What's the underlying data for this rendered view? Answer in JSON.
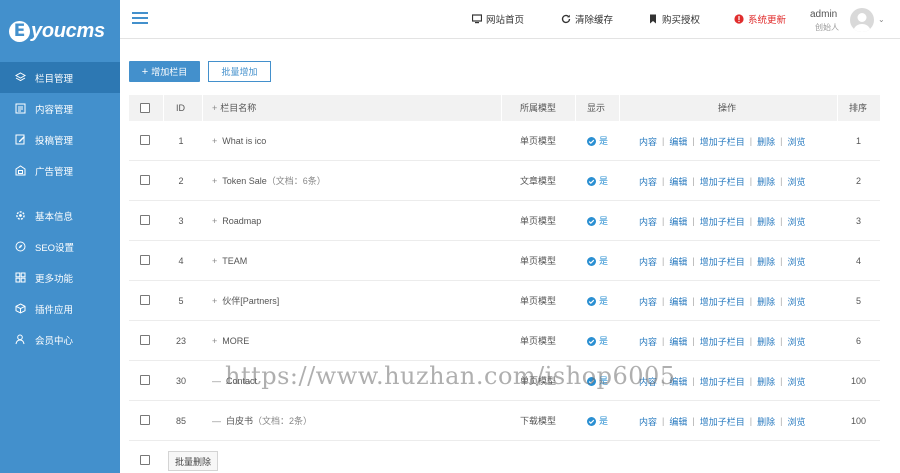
{
  "brand": {
    "logo_mark": "E",
    "logo_text": "youcms"
  },
  "sidebar": {
    "items": [
      {
        "label": "栏目管理",
        "icon": "layers-icon",
        "active": true
      },
      {
        "label": "内容管理",
        "icon": "document-icon",
        "active": false
      },
      {
        "label": "投稿管理",
        "icon": "edit-icon",
        "active": false
      },
      {
        "label": "广告管理",
        "icon": "ad-icon",
        "active": false
      },
      {
        "label": "基本信息",
        "icon": "gear-icon",
        "active": false
      },
      {
        "label": "SEO设置",
        "icon": "compass-icon",
        "active": false
      },
      {
        "label": "更多功能",
        "icon": "grid-icon",
        "active": false
      },
      {
        "label": "插件应用",
        "icon": "cube-icon",
        "active": false
      },
      {
        "label": "会员中心",
        "icon": "user-icon",
        "active": false
      }
    ]
  },
  "topbar": {
    "links": [
      {
        "label": "网站首页",
        "icon": "monitor-icon"
      },
      {
        "label": "清除缓存",
        "icon": "refresh-icon"
      },
      {
        "label": "购买授权",
        "icon": "bookmark-icon"
      },
      {
        "label": "系统更新",
        "icon": "alert-icon"
      }
    ],
    "user_name": "admin",
    "user_role": "创始人"
  },
  "toolbar": {
    "add_label": "增加栏目",
    "batch_label": "批量增加"
  },
  "table": {
    "headers": {
      "id": "ID",
      "name": "栏目名称",
      "model": "所属模型",
      "show": "显示",
      "ops": "操作",
      "sort": "排序"
    },
    "rows": [
      {
        "id": "1",
        "prefix": "+",
        "name": "What is ico",
        "doc": "",
        "model": "单页模型",
        "show": "是",
        "sort": "1"
      },
      {
        "id": "2",
        "prefix": "+",
        "name": "Token Sale",
        "doc": "（文档：6条）",
        "model": "文章模型",
        "show": "是",
        "sort": "2"
      },
      {
        "id": "3",
        "prefix": "+",
        "name": "Roadmap",
        "doc": "",
        "model": "单页模型",
        "show": "是",
        "sort": "3"
      },
      {
        "id": "4",
        "prefix": "+",
        "name": "TEAM",
        "doc": "",
        "model": "单页模型",
        "show": "是",
        "sort": "4"
      },
      {
        "id": "5",
        "prefix": "+",
        "name": "伙伴[Partners]",
        "doc": "",
        "model": "单页模型",
        "show": "是",
        "sort": "5"
      },
      {
        "id": "23",
        "prefix": "+",
        "name": "MORE",
        "doc": "",
        "model": "单页模型",
        "show": "是",
        "sort": "6"
      },
      {
        "id": "30",
        "prefix": "—",
        "name": "Contact",
        "doc": "",
        "model": "单页模型",
        "show": "是",
        "sort": "100"
      },
      {
        "id": "85",
        "prefix": "—",
        "name": "白皮书",
        "doc": "（文档：2条）",
        "model": "下载模型",
        "show": "是",
        "sort": "100"
      }
    ],
    "ops": {
      "content": "内容",
      "edit": "编辑",
      "add_child": "增加子栏目",
      "delete": "删除",
      "browse": "浏览"
    }
  },
  "footer": {
    "batch_delete_label": "批量删除"
  },
  "watermark": "https://www.huzhan.com/ishop6005",
  "colors": {
    "sidebar": "#4390cc",
    "sidebar_active": "#2d78b3",
    "link": "#2a7bc0",
    "alert": "#e02d2d"
  }
}
